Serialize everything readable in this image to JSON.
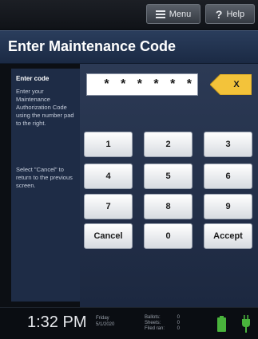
{
  "topbar": {
    "menu_label": "Menu",
    "help_label": "Help"
  },
  "title": "Enter Maintenance Code",
  "sidebar": {
    "heading": "Enter code",
    "instruction": "Enter your Maintenance Authorization Code using the number pad to the right.",
    "cancel_hint": "Select \"Cancel\" to return to the previous screen."
  },
  "code_field": {
    "value": "* * * * * *"
  },
  "clear_button": {
    "label": "X"
  },
  "keypad": {
    "k1": "1",
    "k2": "2",
    "k3": "3",
    "k4": "4",
    "k5": "5",
    "k6": "6",
    "k7": "7",
    "k8": "8",
    "k9": "9",
    "cancel": "Cancel",
    "k0": "0",
    "accept": "Accept"
  },
  "status": {
    "time": "1:32 PM",
    "day": "Friday",
    "date": "5/1/2020",
    "ballots_label": "Ballots:",
    "ballots_value": "0",
    "sheets_label": "Sheets:",
    "sheets_value": "0",
    "filed_label": "Filed ran:",
    "filed_value": "0"
  },
  "colors": {
    "title_bar": "#233552",
    "sidebar": "#1e2c46",
    "clear_button": "#f3c33a",
    "battery": "#49b33c"
  },
  "icons": [
    "hamburger-icon",
    "help-icon",
    "battery-icon",
    "power-plug-icon"
  ]
}
